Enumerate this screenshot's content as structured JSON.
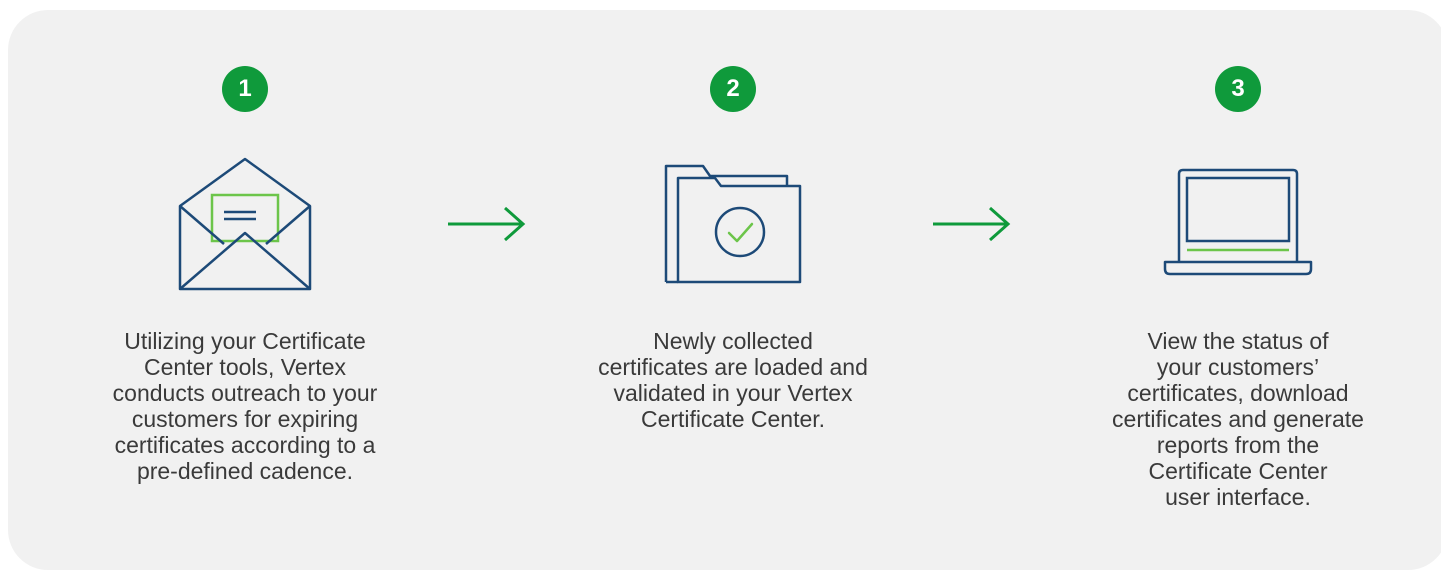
{
  "colors": {
    "panel_background": "#f1f1f1",
    "badge_green": "#0f9a3b",
    "icon_navy": "#1d4a78",
    "accent_green": "#6cc54a",
    "text": "#3a3a3a"
  },
  "steps": [
    {
      "number": "1",
      "icon": "envelope-letter-icon",
      "description_lines": [
        "Utilizing your Certificate",
        "Center tools, Vertex",
        "conducts outreach to your",
        "customers for expiring",
        "certificates according to a",
        "pre-defined cadence."
      ]
    },
    {
      "number": "2",
      "icon": "folder-check-icon",
      "description_lines": [
        "Newly collected",
        "certificates are loaded and",
        "validated in your Vertex",
        "Certificate Center."
      ]
    },
    {
      "number": "3",
      "icon": "laptop-icon",
      "description_lines": [
        "View the status of",
        "your customers’",
        "certificates, download",
        "certificates and generate",
        "reports from the",
        "Certificate Center",
        "user interface."
      ]
    }
  ],
  "arrows": [
    "arrow-right-icon",
    "arrow-right-icon"
  ]
}
